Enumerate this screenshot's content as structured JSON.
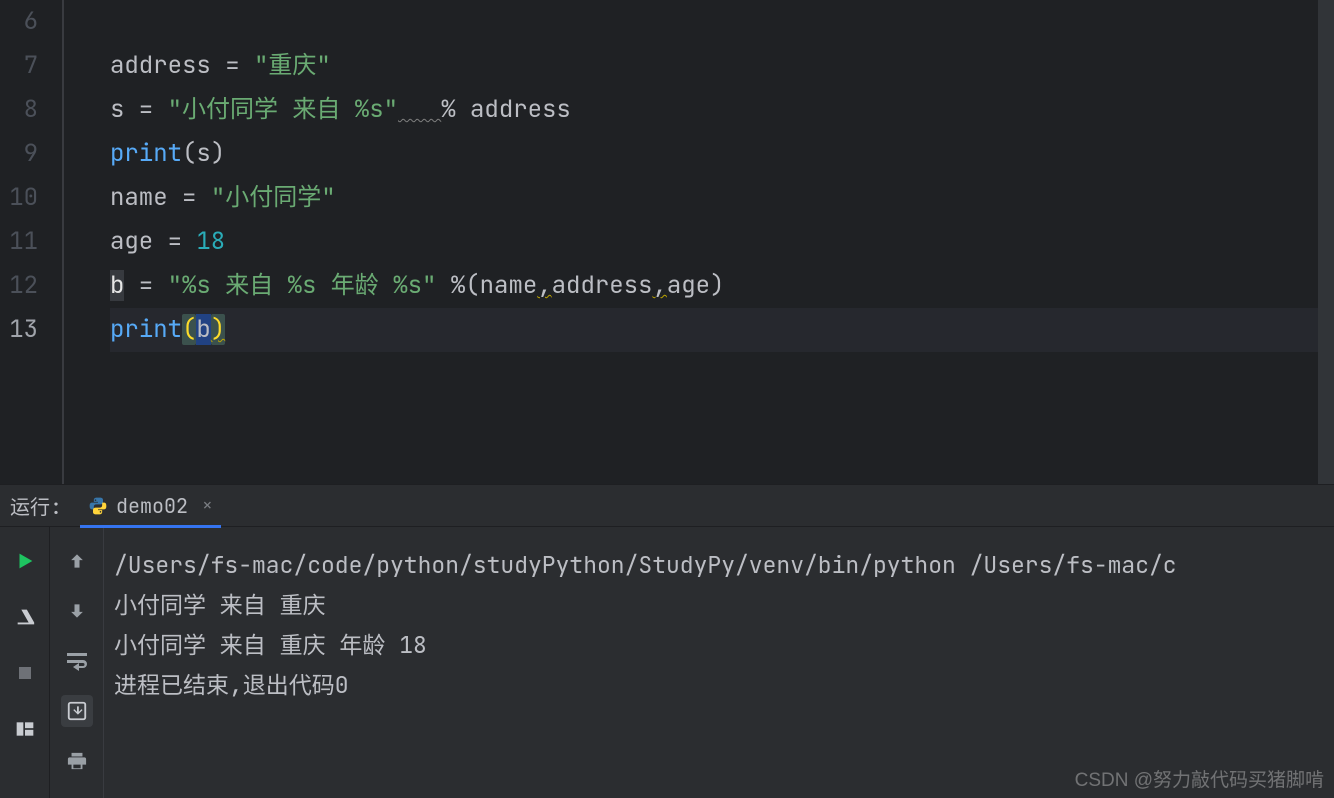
{
  "editor": {
    "lines": [
      {
        "n": 6,
        "active": false
      },
      {
        "n": 7,
        "active": false
      },
      {
        "n": 8,
        "active": false
      },
      {
        "n": 9,
        "active": false
      },
      {
        "n": 10,
        "active": false
      },
      {
        "n": 11,
        "active": false
      },
      {
        "n": 12,
        "active": false
      },
      {
        "n": 13,
        "active": true
      }
    ],
    "code": {
      "l7_var": "address",
      "l7_eq": " = ",
      "l7_str": "\"重庆\"",
      "l8_var": "s",
      "l8_eq": " = ",
      "l8_str": "\"小付同学 来自 %s\"",
      "l8_sp": "   ",
      "l8_pct": "% ",
      "l8_rhs": "address",
      "l9_fn": "print",
      "l9_lp": "(",
      "l9_arg": "s",
      "l9_rp": ")",
      "l10_var": "name",
      "l10_eq": " = ",
      "l10_str": "\"小付同学\"",
      "l11_var": "age",
      "l11_eq": " = ",
      "l11_num": "18",
      "l12_var": "b",
      "l12_eq": " = ",
      "l12_str": "\"%s 来自 %s 年龄 %s\"",
      "l12_sp": " ",
      "l12_pct": "%",
      "l12_lp": "(",
      "l12_a1": "name",
      "l12_c1": ",",
      "l12_a2": "address",
      "l12_c2": ",",
      "l12_a3": "age",
      "l12_rp": ")",
      "l13_fn": "print",
      "l13_lp": "(",
      "l13_arg": "b",
      "l13_rp": ")"
    }
  },
  "run": {
    "label": "运行:",
    "tab_name": "demo02",
    "output": [
      "/Users/fs-mac/code/python/studyPython/StudyPy/venv/bin/python /Users/fs-mac/c",
      "小付同学 来自 重庆",
      "小付同学 来自 重庆 年龄 18",
      "",
      "进程已结束,退出代码0"
    ]
  },
  "watermark": "CSDN @努力敲代码买猪脚啃"
}
